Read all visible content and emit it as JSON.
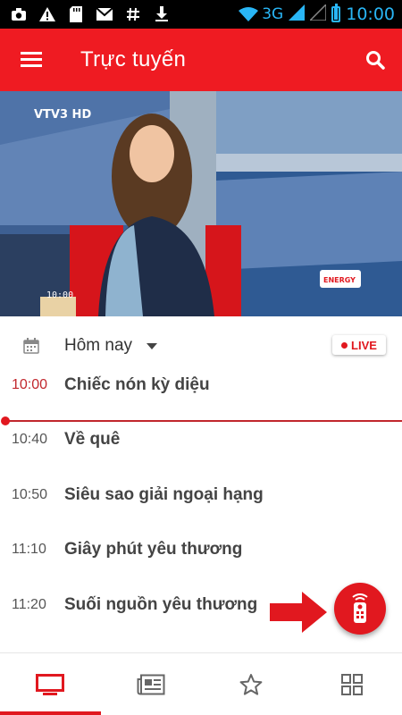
{
  "status_bar": {
    "network": "3G",
    "time": "10:00",
    "icons": [
      "camera-icon",
      "warning-icon",
      "sd-card-icon",
      "mail-icon",
      "hash-icon",
      "download-icon",
      "wifi-icon",
      "signal-icon",
      "battery-icon"
    ]
  },
  "app_bar": {
    "title": "Trực tuyến",
    "menu_icon": "hamburger-icon",
    "search_icon": "search-icon"
  },
  "video": {
    "channel_logo": "VTV3 HD",
    "timestamp_overlay": "10:00",
    "sponsor_logo": "ENERGY"
  },
  "schedule": {
    "date_label": "Hôm nay",
    "live_label": "LIVE",
    "programs": [
      {
        "time": "10:00",
        "title": "Chiếc nón kỳ diệu",
        "current": true
      },
      {
        "time": "10:40",
        "title": "Về quê",
        "current": false
      },
      {
        "time": "10:50",
        "title": "Siêu sao giải ngoại hạng",
        "current": false
      },
      {
        "time": "11:10",
        "title": "Giây phút yêu thương",
        "current": false
      },
      {
        "time": "11:20",
        "title": "Suối nguồn yêu thương",
        "current": false
      }
    ]
  },
  "fab": {
    "icon": "remote-control-icon"
  },
  "bottom_nav": {
    "items": [
      {
        "icon": "tv-icon",
        "active": true
      },
      {
        "icon": "news-icon",
        "active": false
      },
      {
        "icon": "star-icon",
        "active": false
      },
      {
        "icon": "grid-icon",
        "active": false
      }
    ]
  },
  "colors": {
    "accent": "#e1181f",
    "app_bar": "#ef1b22",
    "status_accent": "#29b6f6"
  }
}
